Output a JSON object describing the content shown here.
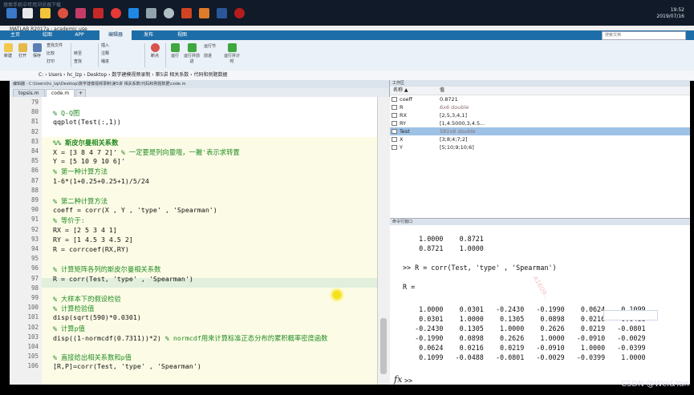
{
  "taskbar": {
    "start_text": "搜索手机中可用浏览器下载",
    "clock_time": "19:52",
    "clock_date": "2019/07/16"
  },
  "window": {
    "title": "MATLAB R2017a - academic use"
  },
  "ribbon": {
    "tabs": [
      "主页",
      "绘图",
      "APP",
      "编辑器",
      "发布",
      "视图"
    ],
    "active_tab": "编辑器",
    "search_placeholder": "搜索文档"
  },
  "toolbar": {
    "new": "新建",
    "open": "打开",
    "save": "保存",
    "find_files": "查找文件",
    "compare": "比较",
    "print": "打印",
    "goto": "转至",
    "find": "查找",
    "insert": "插入",
    "comment": "注释",
    "indent": "缩进",
    "breakpoints": "断点",
    "run": "运行",
    "run_advance": "运行并前进",
    "run_section": "运行节",
    "advance": "前进",
    "run_time": "运行并计时"
  },
  "address_bar": {
    "path": "C: › Users › hc_lzp › Desktop › 数学建模视频录制 › 第5讲 相关系数 › 代码和例题数据"
  },
  "editor": {
    "header": "编辑器 - C:\\Users\\hc_lzp\\Desktop\\数学建模视频录制\\第5讲 相关系数\\代码和例题数据\\code.m",
    "tabs": [
      "topsis.m",
      "code.m",
      "+"
    ],
    "lines": [
      {
        "n": "79",
        "text": ""
      },
      {
        "n": "80",
        "text": "% Q-Q图",
        "comment": true
      },
      {
        "n": "81",
        "text": "qqplot(Test(:,1))"
      },
      {
        "n": "82",
        "text": ""
      },
      {
        "n": "83",
        "text": "%% 斯皮尔曼相关系数",
        "comment": true,
        "bold": true
      },
      {
        "n": "84",
        "text": "X = [3 8 4 7 2]'",
        "trail": " % 一定要是列向量哦，一撇'表示求转置"
      },
      {
        "n": "85",
        "text": "Y = [5 10 9 10 6]'"
      },
      {
        "n": "86",
        "text": "% 第一种计算方法",
        "comment": true
      },
      {
        "n": "87",
        "text": "1-6*(1+0.25+0.25+1)/5/24"
      },
      {
        "n": "88",
        "text": ""
      },
      {
        "n": "89",
        "text": "% 第二种计算方法",
        "comment": true
      },
      {
        "n": "90",
        "text": "coeff = corr(X , Y , 'type' , 'Spearman')"
      },
      {
        "n": "91",
        "text": "% 等价于:",
        "comment": true
      },
      {
        "n": "92",
        "text": "RX = [2 5 3 4 1]"
      },
      {
        "n": "93",
        "text": "RY = [1 4.5 3 4.5 2]"
      },
      {
        "n": "94",
        "text": "R = corrcoef(RX,RY)"
      },
      {
        "n": "95",
        "text": ""
      },
      {
        "n": "96",
        "text": "% 计算矩阵各列的斯皮尔曼相关系数",
        "comment": true
      },
      {
        "n": "97",
        "text": "R = corr(Test, 'type' , 'Spearman')"
      },
      {
        "n": "98",
        "text": ""
      },
      {
        "n": "99",
        "text": "% 大样本下的假设检验",
        "comment": true
      },
      {
        "n": "100",
        "text": "% 计算检验值",
        "comment": true
      },
      {
        "n": "101",
        "text": "disp(sqrt(590)*0.0301)"
      },
      {
        "n": "102",
        "text": "% 计算p值",
        "comment": true
      },
      {
        "n": "103",
        "text": "disp((1-normcdf(0.7311))*2)",
        "trail": " % normcdf用来计算标准正态分布的累积概率密度函数"
      },
      {
        "n": "104",
        "text": ""
      },
      {
        "n": "105",
        "text": "% 直接给出相关系数和p值",
        "comment": true
      },
      {
        "n": "106",
        "text": "[R,P]=corr(Test, 'type' , 'Spearman')"
      }
    ]
  },
  "workspace": {
    "title": "工作区",
    "col_name": "名称 ▲",
    "col_value": "值",
    "vars": [
      {
        "name": "coeff",
        "value": "0.8721"
      },
      {
        "name": "R",
        "value": "6x6 double",
        "italic": true
      },
      {
        "name": "RX",
        "value": "[2,5,3,4,1]"
      },
      {
        "name": "RY",
        "value": "[1,4.5000,3,4.5..."
      },
      {
        "name": "Test",
        "value": "591x6 double",
        "italic": true,
        "selected": true
      },
      {
        "name": "X",
        "value": "[3;8;4;7;2]"
      },
      {
        "name": "Y",
        "value": "[5;10;9;10;6]"
      }
    ]
  },
  "command_window": {
    "title": "命令行窗口",
    "lines": [
      "    1.0000    0.8721",
      "    0.8721    1.0000",
      "",
      ">> R = corr(Test, 'type' , 'Spearman')",
      "",
      "R =",
      "",
      "    1.0000    0.0301   -0.2430   -0.1990    0.0624    0.1099",
      "    0.0301    1.0000    0.1305    0.0898    0.0216   -0.0488",
      "   -0.2430    0.1305    1.0000    0.2626    0.0219   -0.0801",
      "   -0.1990    0.0898    0.2626    1.0000   -0.0910   -0.0029",
      "    0.0624    0.0216    0.0219   -0.0910    1.0000   -0.0399",
      "    0.1099   -0.0488   -0.0801   -0.0029   -0.0399    1.0000"
    ],
    "prompt": ">>",
    "watermark": "A1609..."
  },
  "footer": {
    "credit": "CSDN @Wei&Yan"
  }
}
